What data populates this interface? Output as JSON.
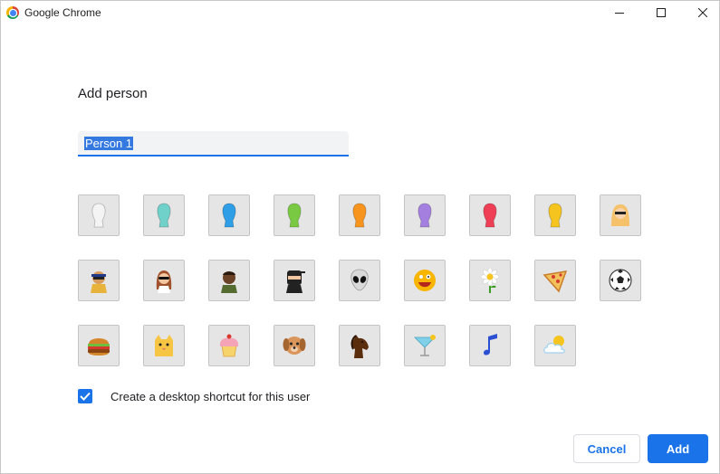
{
  "window": {
    "title": "Google Chrome"
  },
  "dialog": {
    "heading": "Add person",
    "name_value": "Person 1",
    "shortcut_checked": true,
    "shortcut_label": "Create a desktop shortcut for this user",
    "cancel_label": "Cancel",
    "add_label": "Add"
  },
  "avatars": [
    {
      "name": "avatar-white-silhouette",
      "icon": "silhouette",
      "color": "#f4f4f4"
    },
    {
      "name": "avatar-teal-silhouette",
      "icon": "silhouette",
      "color": "#6fd1c9"
    },
    {
      "name": "avatar-blue-silhouette",
      "icon": "silhouette",
      "color": "#2e9ee6"
    },
    {
      "name": "avatar-green-silhouette",
      "icon": "silhouette",
      "color": "#7ac943"
    },
    {
      "name": "avatar-orange-silhouette",
      "icon": "silhouette",
      "color": "#f7941d"
    },
    {
      "name": "avatar-purple-silhouette",
      "icon": "silhouette",
      "color": "#a57fe0"
    },
    {
      "name": "avatar-red-silhouette",
      "icon": "silhouette",
      "color": "#ee3f56"
    },
    {
      "name": "avatar-yellow-silhouette",
      "icon": "silhouette",
      "color": "#f6c41e"
    },
    {
      "name": "avatar-blonde-woman",
      "icon": "blonde-woman",
      "color": "#f5c26b"
    },
    {
      "name": "avatar-ninja-cat-man",
      "icon": "masked-man",
      "color": "#e8b33a"
    },
    {
      "name": "avatar-woman-sunglasses",
      "icon": "woman-sunglasses",
      "color": "#a0522d"
    },
    {
      "name": "avatar-man-dark-skin",
      "icon": "man",
      "color": "#6b4226"
    },
    {
      "name": "avatar-ninja",
      "icon": "ninja",
      "color": "#222222"
    },
    {
      "name": "avatar-alien",
      "icon": "alien",
      "color": "#d9d9d9"
    },
    {
      "name": "avatar-smiley",
      "icon": "smiley",
      "color": "#f7b500"
    },
    {
      "name": "avatar-flower",
      "icon": "flower",
      "color": "#ffffff"
    },
    {
      "name": "avatar-pizza",
      "icon": "pizza",
      "color": "#f2c15b"
    },
    {
      "name": "avatar-soccer-ball",
      "icon": "soccer-ball",
      "color": "#222222"
    },
    {
      "name": "avatar-burger",
      "icon": "burger",
      "color": "#8b4513"
    },
    {
      "name": "avatar-cat",
      "icon": "cat",
      "color": "#f7c544"
    },
    {
      "name": "avatar-cupcake",
      "icon": "cupcake",
      "color": "#f5a3b6"
    },
    {
      "name": "avatar-dog",
      "icon": "dog",
      "color": "#d9955a"
    },
    {
      "name": "avatar-horse",
      "icon": "horse",
      "color": "#5a2d0c"
    },
    {
      "name": "avatar-cocktail",
      "icon": "cocktail",
      "color": "#7fd0e8"
    },
    {
      "name": "avatar-music-note",
      "icon": "music-note",
      "color": "#2a4fd3"
    },
    {
      "name": "avatar-sun-cloud",
      "icon": "sun-cloud",
      "color": "#9fd0f0"
    }
  ]
}
